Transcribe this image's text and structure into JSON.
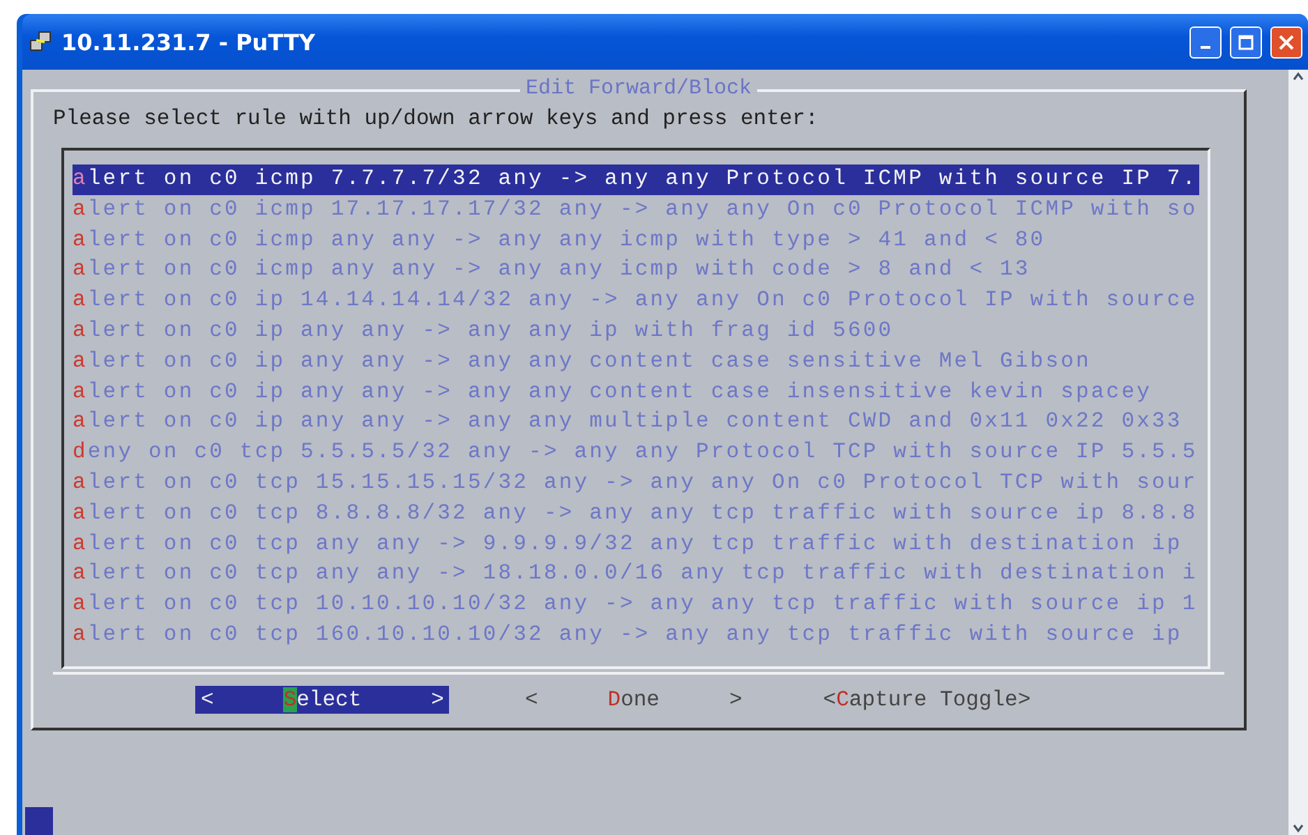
{
  "window": {
    "title": "10.11.231.7 - PuTTY"
  },
  "dialog": {
    "title": "Edit Forward/Block",
    "prompt": "Please select rule with up/down arrow keys and press enter:",
    "rules": [
      {
        "text": "alert on c0 icmp 7.7.7.7/32 any -> any any Protocol ICMP with source IP 7.",
        "selected": true
      },
      {
        "text": "alert on c0 icmp 17.17.17.17/32 any -> any any On c0 Protocol ICMP with so",
        "selected": false
      },
      {
        "text": "alert on c0 icmp any any -> any any icmp with type > 41 and < 80",
        "selected": false
      },
      {
        "text": "alert on c0 icmp any any -> any any icmp with code > 8 and < 13",
        "selected": false
      },
      {
        "text": "alert on c0 ip 14.14.14.14/32 any -> any any On c0 Protocol IP with source",
        "selected": false
      },
      {
        "text": "alert on c0 ip any any -> any any ip with frag id 5600",
        "selected": false
      },
      {
        "text": "alert on c0 ip any any -> any any content case sensitive Mel Gibson",
        "selected": false
      },
      {
        "text": "alert on c0 ip any any -> any any content case insensitive kevin spacey",
        "selected": false
      },
      {
        "text": "alert on c0 ip any any -> any any multiple content CWD and 0x11 0x22 0x33",
        "selected": false
      },
      {
        "text": "deny on c0 tcp 5.5.5.5/32 any -> any any Protocol TCP with source IP 5.5.5",
        "selected": false
      },
      {
        "text": "alert on c0 tcp 15.15.15.15/32 any -> any any On c0 Protocol TCP with sour",
        "selected": false
      },
      {
        "text": "alert on c0 tcp 8.8.8.8/32 any -> any any tcp traffic with source ip 8.8.8",
        "selected": false
      },
      {
        "text": "alert on c0 tcp any any -> 9.9.9.9/32 any tcp traffic with destination ip",
        "selected": false
      },
      {
        "text": "alert on c0 tcp any any -> 18.18.0.0/16 any tcp traffic with destination i",
        "selected": false
      },
      {
        "text": "alert on c0 tcp 10.10.10.10/32 any -> any any tcp traffic with source ip 1",
        "selected": false
      },
      {
        "text": "alert on c0 tcp 160.10.10.10/32 any -> any any tcp traffic with source ip",
        "selected": false
      }
    ],
    "buttons": [
      {
        "kind": "wide",
        "left": "<",
        "label": "Select",
        "right": ">",
        "selected": true
      },
      {
        "kind": "wide",
        "left": "<",
        "label": "Done",
        "right": ">",
        "selected": false
      },
      {
        "kind": "tight",
        "left": "<",
        "label": "Capture Toggle",
        "right": ">",
        "selected": false
      }
    ]
  }
}
